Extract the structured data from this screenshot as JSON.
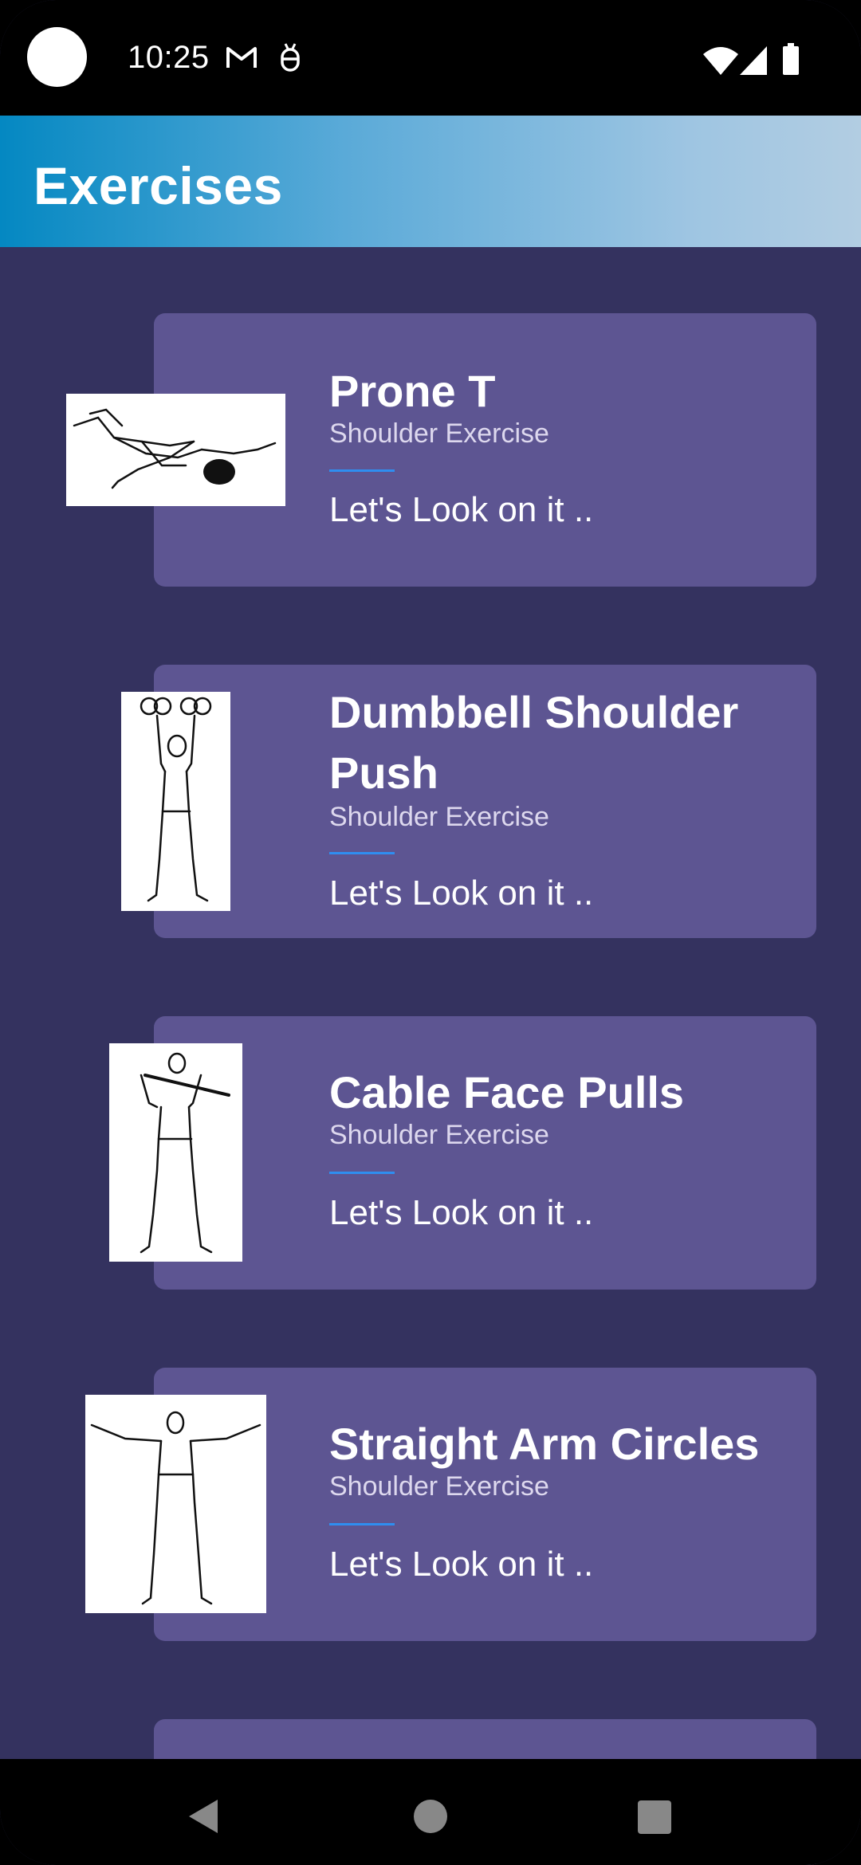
{
  "status_bar": {
    "time": "10:25"
  },
  "app_bar": {
    "title": "Exercises"
  },
  "exercises": [
    {
      "title": "Prone T",
      "subtitle": "Shoulder Exercise",
      "link": "Let's Look on it .."
    },
    {
      "title": "Dumbbell Shoulder Push",
      "subtitle": "Shoulder Exercise",
      "link": "Let's Look on it .."
    },
    {
      "title": "Cable Face Pulls",
      "subtitle": "Shoulder Exercise",
      "link": "Let's Look on it .."
    },
    {
      "title": "Straight Arm Circles",
      "subtitle": "Shoulder Exercise",
      "link": "Let's Look on it .."
    }
  ],
  "icons": {
    "status": [
      "gmail-icon",
      "debug-icon",
      "wifi-icon",
      "signal-icon",
      "battery-icon"
    ],
    "nav": [
      "back-icon",
      "home-icon",
      "recents-icon"
    ]
  },
  "colors": {
    "background": "#34325f",
    "card": "#5d5592",
    "accent": "#2f8ef0",
    "app_bar_start": "#0488c2",
    "app_bar_end": "#b2cde2"
  }
}
